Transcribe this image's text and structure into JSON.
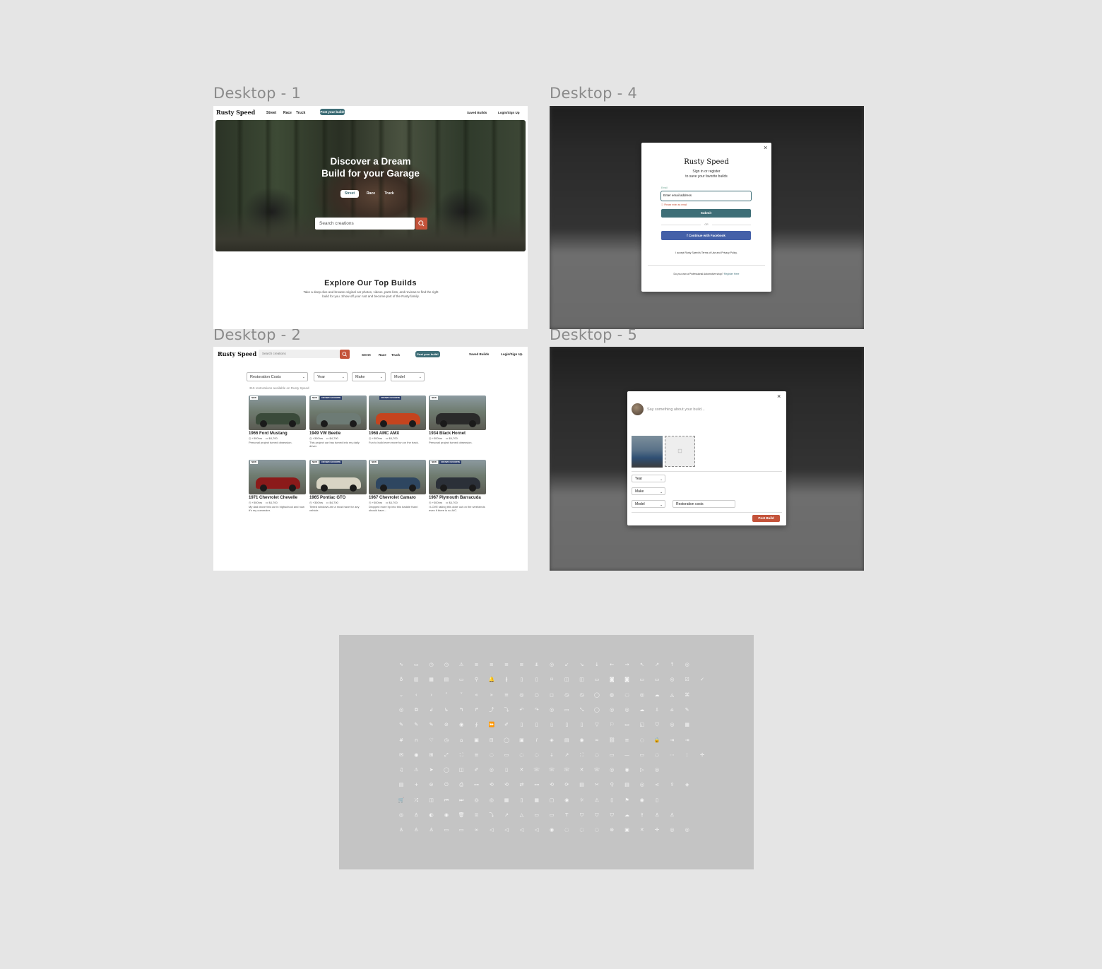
{
  "frames": {
    "d1": "Desktop - 1",
    "d2": "Desktop - 2",
    "d4": "Desktop - 4",
    "d5": "Desktop - 5"
  },
  "nav": {
    "brand": "Rusty Speed",
    "links": [
      "Street",
      "Race",
      "Truck"
    ],
    "post_button": "Post your build!",
    "saved": "Saved Builds",
    "login": "Login/Sign Up",
    "accent_color": "#3e6e77",
    "search_button_color": "#c4533a"
  },
  "home": {
    "hero_title_line1": "Discover a Dream",
    "hero_title_line2": "Build for your Garage",
    "segments": [
      "Street",
      "Race",
      "Truck"
    ],
    "active_segment": "Street",
    "search_placeholder": "Search creations",
    "explore_title": "Explore Our Top Builds",
    "explore_sub": "Take a deep dive and browse original car photos, videos, parts lists, and reviews to find the right build for you. Show off your rust and become part of the Rusty family."
  },
  "listing": {
    "search_placeholder": "Search creations",
    "filters": [
      "Restoration Costs",
      "Year",
      "Make",
      "Model"
    ],
    "count_text": "315 restorations available on Rusty Speed",
    "cards": [
      {
        "title": "1966 Ford Mustang",
        "hours": "+300hrs",
        "cost": "$4,700",
        "desc": "Personal project turned obsession.",
        "badge": "NEW",
        "badge2": "",
        "color": "#3a4a3a"
      },
      {
        "title": "1949 VW Beetle",
        "hours": "+300hrs",
        "cost": "$4,700",
        "desc": "This project car has turned into my daily driver.",
        "badge": "NEW",
        "badge2": "CROWD FAVORITE",
        "color": "#6d7b75"
      },
      {
        "title": "1968 AMC AMX",
        "hours": "+300hrs",
        "cost": "$4,700",
        "desc": "Fun to build even more fun on the track.",
        "badge": "",
        "badge2": "CROWD FAVORITE",
        "color": "#c5441e"
      },
      {
        "title": "1934 Black Hornet",
        "hours": "+300hrs",
        "cost": "$4,700",
        "desc": "Personal project turned obsession.",
        "badge": "NEW",
        "badge2": "",
        "color": "#2a2a2a"
      },
      {
        "title": "1971 Chevrolet Chevelle",
        "hours": "+300hrs",
        "cost": "$4,700",
        "desc": "My dad drove this car in highschool and now it's my commuter.",
        "badge": "NEW",
        "badge2": "",
        "color": "#8b1a1a"
      },
      {
        "title": "1965 Pontiac GTO",
        "hours": "+300hrs",
        "cost": "$4,700",
        "desc": "Tinted windows are a must have for any vehicle.",
        "badge": "NEW",
        "badge2": "CROWD FAVORITE",
        "color": "#d8d4c4"
      },
      {
        "title": "1967 Chevrolet Camaro",
        "hours": "+300hrs",
        "cost": "$4,700",
        "desc": "Dropped more hp into this baddie than I should have...",
        "badge": "NEW",
        "badge2": "",
        "color": "#2e4660"
      },
      {
        "title": "1967 Plymouth Barracuda",
        "hours": "+300hrs",
        "cost": "$4,700",
        "desc": "I LOVE taking this oldie out on the weekends even if there is no A/C.",
        "badge": "NEW",
        "badge2": "CROWD FAVORITE",
        "color": "#2b3038"
      }
    ]
  },
  "signin": {
    "title": "Rusty Speed",
    "subtitle_line1": "Sign in or register",
    "subtitle_line2": "to save your favorite builds",
    "email_label": "Email",
    "email_value": "Enter email address",
    "error": "Please enter an email",
    "submit": "Submit",
    "or": "OR",
    "facebook": "Continue with Facebook",
    "facebook_color": "#4460a8",
    "terms": "I accept Rusty Speed's Terms of Use and Privacy Policy.",
    "pro_prompt": "Do you own a Professional Automotive shop?",
    "register": "Register Here"
  },
  "post": {
    "placeholder": "Say something about your build...",
    "selects": [
      "Year",
      "Make",
      "Model"
    ],
    "restoration_field": "Restoration costs",
    "post_button": "Post Build"
  },
  "icons": {
    "rows": [
      "∿▭◷◷⚠≡≡≡≡⚓◎↙↘↓←→↖↗↑◎",
      "♁▥▦▤▭⚲🔔∦▯▯⌑◫◫▭◙◙▭▭◎☑✓",
      "⌄‹›˄˅«»≡◎○◻◷◷◯◍◌◎☁◬⌘",
      "◎⧉↲↳↰↱⤴⤵↶↷◎▭⤡◯◎◎☁⇩⌂✎",
      "✎✎✎⊘◉∮⏩✐▯▯▯▯▯▽⚐▭◱⛉◎▦",
      "#∩♡◷⌂▣⊟◯▣𝐼◈▤◉∞⛓≡◌🔒⇥⇥",
      "✉◉⊞⤢⛶≡◌▭◌◌⇣↗⛶◌▭—▭◌⋯⋮✢",
      "♫⚠➤◯◫✐◎▯✕☏☏☏✕☏◎◉▷◎",
      "▤+⊜⏻⎙⊶⟲⟲⇄⊶⟲⟳▤✂⚲▤◎⋖⇪◈",
      "🛒⤮◫⏮⏭◎◎▦▯▦▢◉☼⚠▯⚑◉▯",
      "◎♙◐◉🗑⌸⤵↗△▭▭T⛉⛉⛉☁⇪♙♙",
      "♙♙♙▭▭∞◁◁◁◁◉◌◌◌⊛▣✕✢◎◎"
    ]
  }
}
